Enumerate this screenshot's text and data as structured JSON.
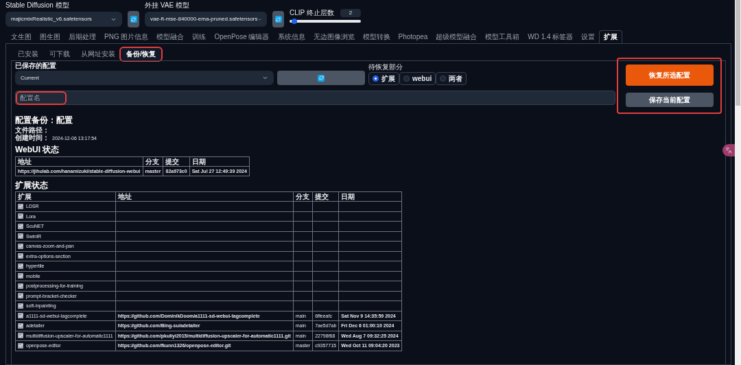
{
  "model_bar": {
    "sd_model": {
      "label": "Stable Diffusion 模型",
      "value": "majicmixRealistic_v6.safetensors"
    },
    "vae": {
      "label": "外挂 VAE 模型",
      "value": "vae-ft-mse-840000-ema-pruned.safetensors"
    },
    "clip": {
      "label": "CLIP 终止层数",
      "value": "2",
      "level": 0.06
    }
  },
  "main_tabs": [
    {
      "label": "文生图",
      "selected": false
    },
    {
      "label": "图生图",
      "selected": false
    },
    {
      "label": "后期处理",
      "selected": false
    },
    {
      "label": "PNG 图片信息",
      "selected": false
    },
    {
      "label": "模型融合",
      "selected": false
    },
    {
      "label": "训练",
      "selected": false
    },
    {
      "label": "OpenPose 编辑器",
      "selected": false
    },
    {
      "label": "系统信息",
      "selected": false
    },
    {
      "label": "无边图像浏览",
      "selected": false
    },
    {
      "label": "模型转换",
      "selected": false
    },
    {
      "label": "Photopea",
      "selected": false
    },
    {
      "label": "超级模型融合",
      "selected": false
    },
    {
      "label": "模型工具箱",
      "selected": false
    },
    {
      "label": "WD 1.4 标签器",
      "selected": false
    },
    {
      "label": "设置",
      "selected": false
    },
    {
      "label": "扩展",
      "selected": true
    }
  ],
  "sub_tabs": [
    {
      "label": "已安装",
      "selected": false,
      "highlighted": false
    },
    {
      "label": "可下载",
      "selected": false,
      "highlighted": false
    },
    {
      "label": "从网址安装",
      "selected": false,
      "highlighted": false
    },
    {
      "label": "备份/恢复",
      "selected": true,
      "highlighted": true
    }
  ],
  "backup": {
    "saved_label": "已保存的配置",
    "saved_value": "Current",
    "restore_label": "待恢复部分",
    "restore_options": [
      {
        "label": "扩展",
        "selected": true
      },
      {
        "label": "webui",
        "selected": false
      },
      {
        "label": "两者",
        "selected": false
      }
    ],
    "name_placeholder": "配置名",
    "name_highlighted": true,
    "actions_highlighted": true,
    "restore_button": "恢复所选配置",
    "save_button": "保存当前配置"
  },
  "report": {
    "title": "配置备份：配置",
    "path_label": "文件路径：",
    "time_label": "创建时间：",
    "time_value": "2024-12-06 13:17:54",
    "webui_heading": "WebUI 状态",
    "webui_table": {
      "columns": [
        "地址",
        "分支",
        "提交",
        "日期"
      ],
      "rows": [
        [
          "https://jihulab.com/hanamizuki/stable-diffusion-webui",
          "master",
          "82a973c0",
          "Sat Jul 27 12:49:39 2024"
        ]
      ]
    },
    "ext_heading": "扩展状态",
    "ext_table": {
      "columns": [
        "扩展",
        "地址",
        "分支",
        "提交",
        "日期"
      ],
      "rows": [
        {
          "name": "LDSR",
          "checked": true
        },
        {
          "name": "Lora",
          "checked": true
        },
        {
          "name": "ScuNET",
          "checked": true
        },
        {
          "name": "SwinIR",
          "checked": true
        },
        {
          "name": "canvas-zoom-and-pan",
          "checked": true
        },
        {
          "name": "extra-options-section",
          "checked": true
        },
        {
          "name": "hypertile",
          "checked": true
        },
        {
          "name": "mobile",
          "checked": true
        },
        {
          "name": "postprocessing-for-training",
          "checked": true
        },
        {
          "name": "prompt-bracket-checker",
          "checked": true
        },
        {
          "name": "soft-inpainting",
          "checked": true
        },
        {
          "name": "a1111-sd-webui-tagcomplete",
          "checked": true,
          "url": "https://github.com/DominikDoom/a1111-sd-webui-tagcomplete",
          "branch": "main",
          "commit": "6ffeeafc",
          "date": "Sat Nov 9 14:35:59 2024"
        },
        {
          "name": "adetailer",
          "checked": true,
          "url": "https://github.com/Bing-su/adetailer",
          "branch": "main",
          "commit": "7ae5d7ab",
          "date": "Fri Dec 6 01:00:10 2024"
        },
        {
          "name": "multidiffusion-upscaler-for-automatic1111",
          "checked": true,
          "url": "https://github.com/pkuliyi2015/multidiffusion-upscaler-for-automatic1111.git",
          "branch": "main",
          "commit": "22798f68",
          "date": "Wed Aug 7 09:32:25 2024"
        },
        {
          "name": "openpose-editor",
          "checked": true,
          "url": "https://github.com/fkunn1326/openpose-editor.git",
          "branch": "master",
          "commit": "c9357715",
          "date": "Wed Oct 11 09:04:20 2023"
        }
      ]
    }
  }
}
